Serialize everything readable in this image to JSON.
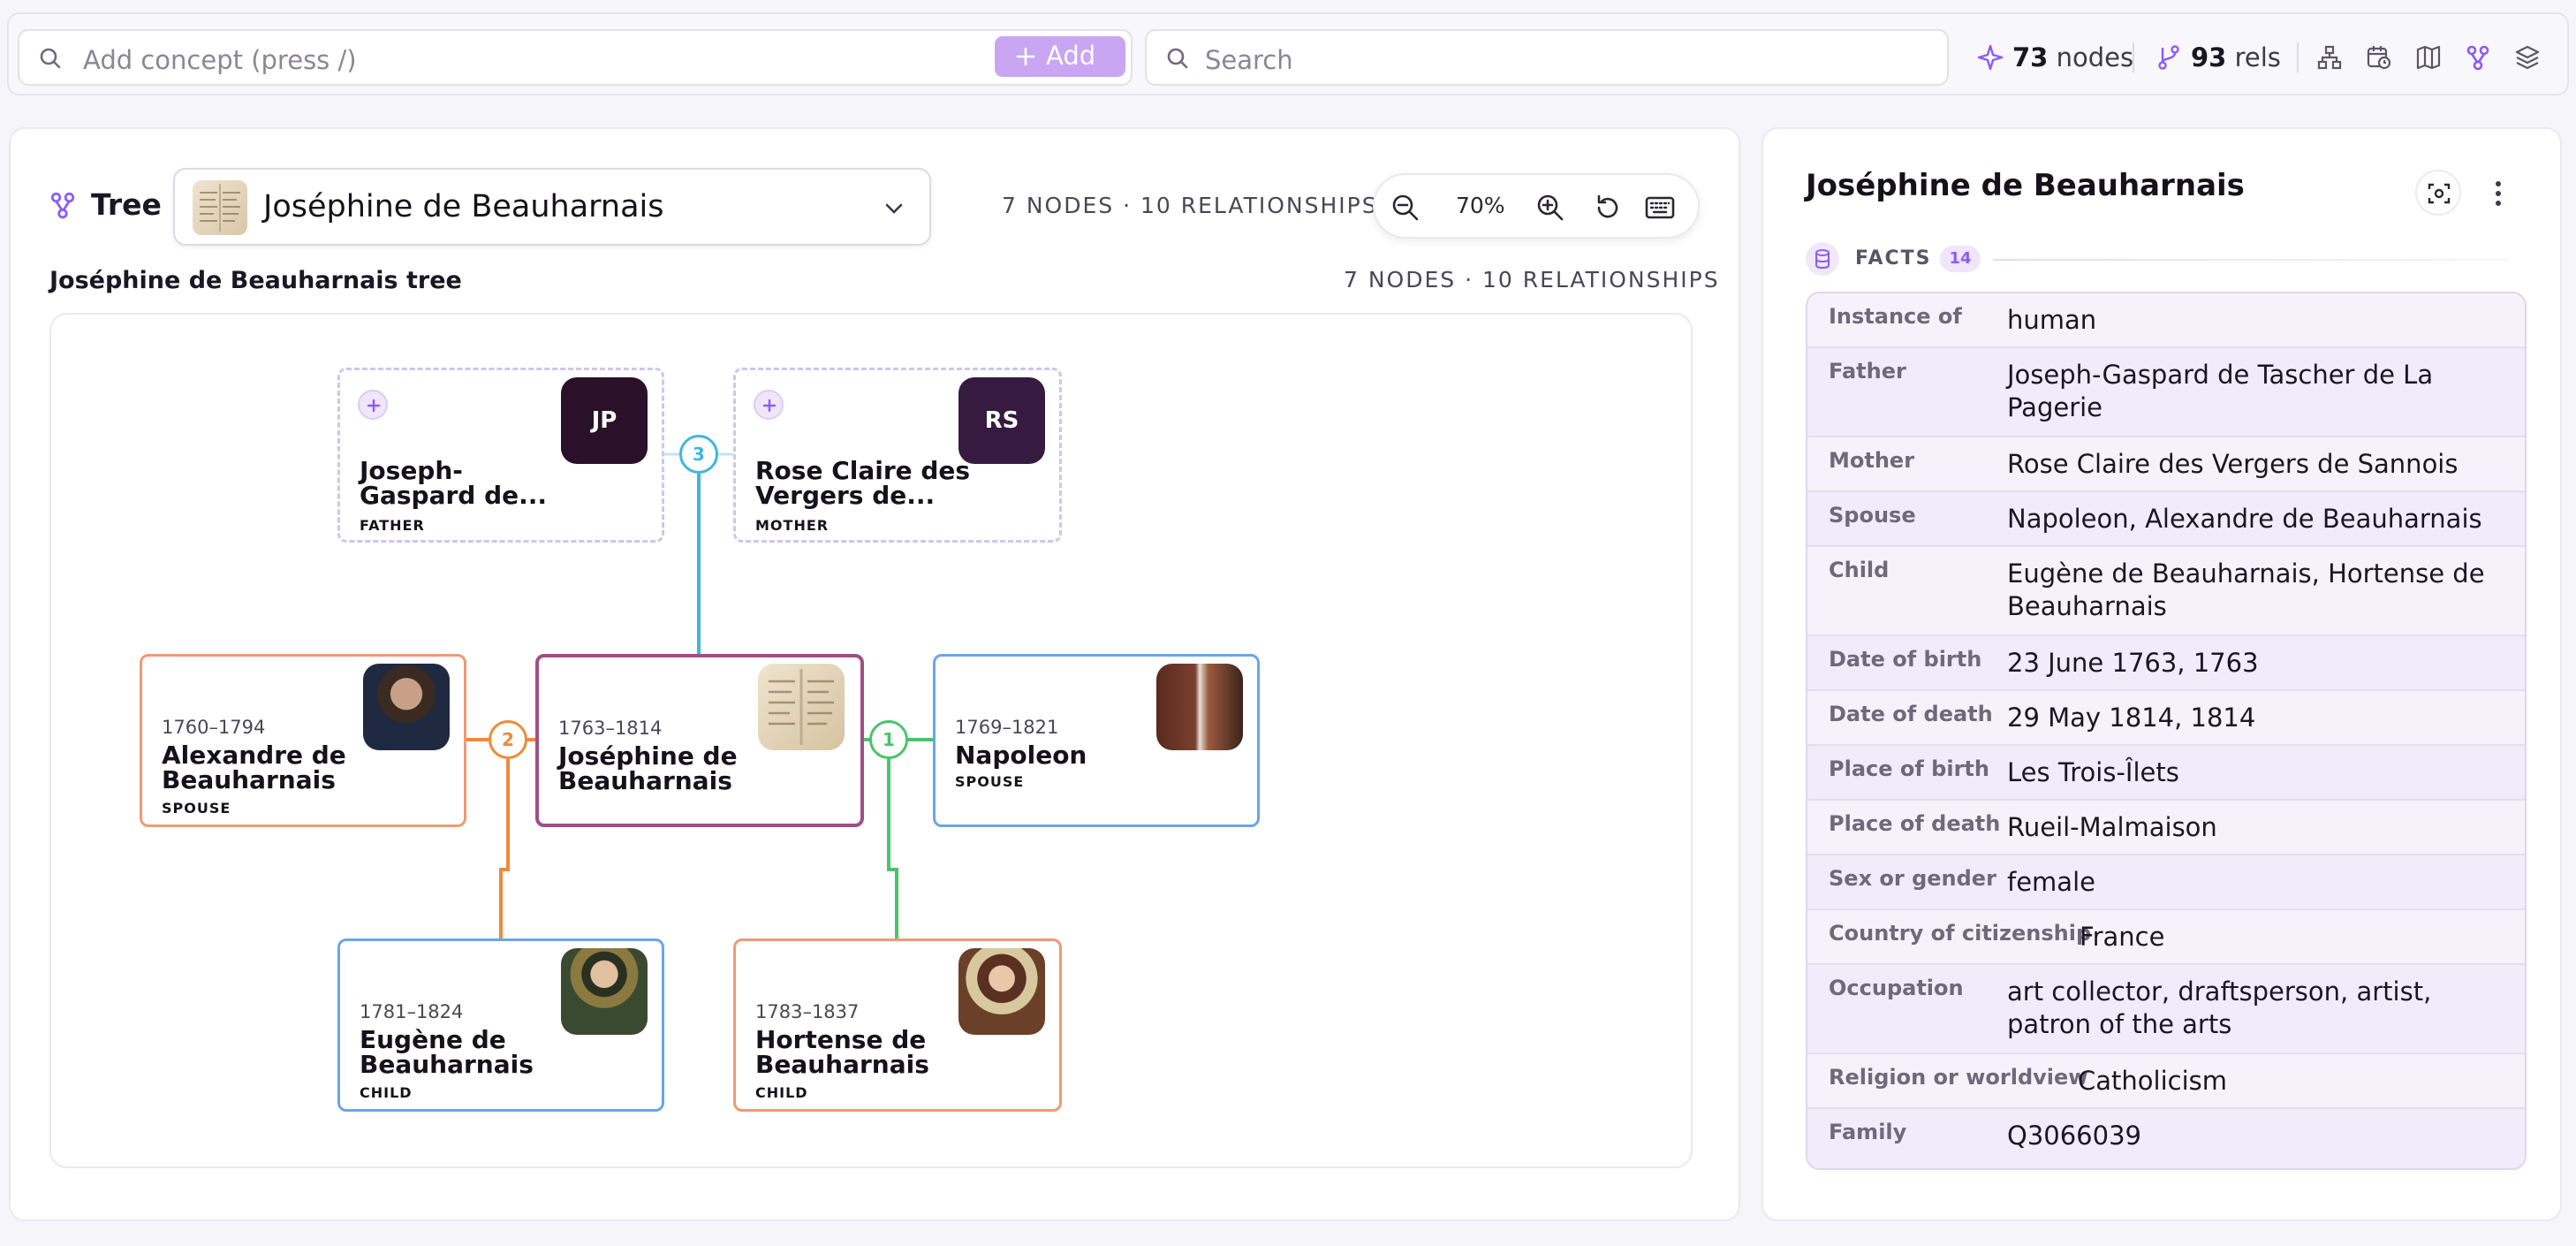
{
  "topbar": {
    "add_placeholder": "Add concept (press /)",
    "add_label": "Add",
    "search_placeholder": "Search",
    "nodes_count": "73",
    "nodes_label": "nodes",
    "rels_count": "93",
    "rels_label": "rels",
    "view_icons": [
      "hierarchy-icon",
      "calendar-clock-icon",
      "map-icon",
      "tree-icon",
      "layers-icon"
    ],
    "active_view": "tree-icon"
  },
  "tree_panel": {
    "title": "Tree",
    "selected_person": "Joséphine de Beauharnais",
    "header_stats": "7 NODES · 10 RELATIONSHIPS",
    "zoom": "70%",
    "subtitle": "Joséphine de Beauharnais tree",
    "sub_stats": "7 NODES · 10 RELATIONSHIPS"
  },
  "nodes": {
    "father": {
      "initials": "JP",
      "name_line1": "Joseph-",
      "name_line2": "Gaspard de...",
      "role": "FATHER"
    },
    "mother": {
      "initials": "RS",
      "name_line1": "Rose Claire des",
      "name_line2": "Vergers de...",
      "role": "MOTHER"
    },
    "spouse1": {
      "years": "1760–1794",
      "name_line1": "Alexandre de",
      "name_line2": "Beauharnais",
      "role": "SPOUSE"
    },
    "focus": {
      "years": "1763–1814",
      "name_line1": "Joséphine de",
      "name_line2": "Beauharnais"
    },
    "spouse2": {
      "years": "1769–1821",
      "name_line1": "Napoleon",
      "role": "SPOUSE"
    },
    "child1": {
      "years": "1781–1824",
      "name_line1": "Eugène de",
      "name_line2": "Beauharnais",
      "role": "CHILD"
    },
    "child2": {
      "years": "1783–1837",
      "name_line1": "Hortense de",
      "name_line2": "Beauharnais",
      "role": "CHILD"
    }
  },
  "badges": {
    "parents": "3",
    "spouse1": "2",
    "spouse2": "1"
  },
  "colors": {
    "accent": "#8b5cf6",
    "parents_line": "#3fb6e0",
    "spouse1_line": "#ef8a3c",
    "spouse2_line": "#49c46a",
    "focus_border": "#a04e86"
  },
  "detail": {
    "title": "Joséphine de Beauharnais",
    "facts_label": "FACTS",
    "facts_count": "14",
    "facts": [
      {
        "k": "Instance of",
        "v": "human"
      },
      {
        "k": "Father",
        "v": "Joseph-Gaspard de Tascher de La Pagerie"
      },
      {
        "k": "Mother",
        "v": "Rose Claire des Vergers de Sannois"
      },
      {
        "k": "Spouse",
        "v": "Napoleon, Alexandre de Beauharnais"
      },
      {
        "k": "Child",
        "v": "Eugène de Beauharnais, Hortense de Beauharnais"
      },
      {
        "k": "Date of birth",
        "v": "23 June 1763, 1763"
      },
      {
        "k": "Date of death",
        "v": "29 May 1814, 1814"
      },
      {
        "k": "Place of birth",
        "v": "Les Trois-Îlets"
      },
      {
        "k": "Place of death",
        "v": "Rueil-Malmaison"
      },
      {
        "k": "Sex or gender",
        "v": "female"
      },
      {
        "k": "Country of citizenship",
        "v": "France"
      },
      {
        "k": "Occupation",
        "v": "art collector, draftsperson, artist, patron of the arts"
      },
      {
        "k": "Religion or worldview",
        "v": "Catholicism"
      },
      {
        "k": "Family",
        "v": "Q3066039"
      }
    ]
  }
}
